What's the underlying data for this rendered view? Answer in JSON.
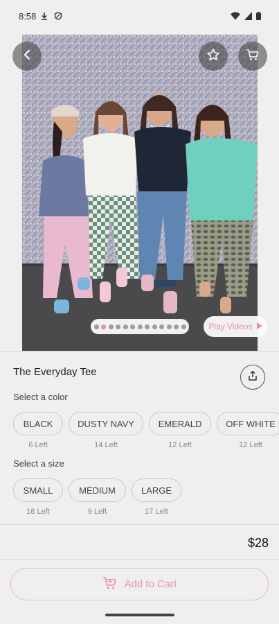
{
  "status_bar": {
    "time": "8:58"
  },
  "gallery": {
    "play_label": "Play Videos",
    "dot_count": 13,
    "active_index": 1
  },
  "product": {
    "title": "The Everyday Tee",
    "price": "$28"
  },
  "colors": {
    "label": "Select a color",
    "options": [
      {
        "name": "BLACK",
        "stock": "6 Left"
      },
      {
        "name": "DUSTY NAVY",
        "stock": "14 Left"
      },
      {
        "name": "EMERALD",
        "stock": "12 Left"
      },
      {
        "name": "OFF WHITE",
        "stock": "12 Left"
      }
    ]
  },
  "sizes": {
    "label": "Select a size",
    "options": [
      {
        "name": "SMALL",
        "stock": "18 Left"
      },
      {
        "name": "MEDIUM",
        "stock": "9 Left"
      },
      {
        "name": "LARGE",
        "stock": "17 Left"
      }
    ]
  },
  "actions": {
    "add_to_cart": "Add to Cart"
  },
  "theme": {
    "accent": "#e98fa9",
    "background": "#efefef"
  }
}
